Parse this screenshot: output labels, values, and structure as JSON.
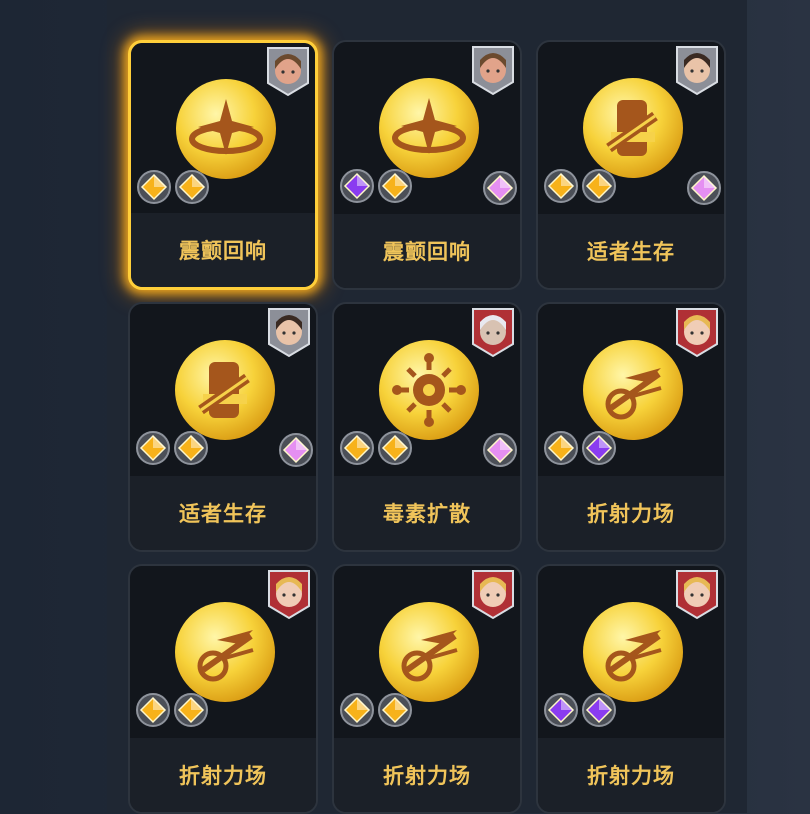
{
  "cards": [
    {
      "name": "震颤回响",
      "icon": "swirl-icon",
      "portrait": "dwarf-portrait",
      "selected": true,
      "gems": [
        "gold",
        "gold"
      ],
      "extra_gem": null
    },
    {
      "name": "震颤回响",
      "icon": "swirl-icon",
      "portrait": "dwarf-portrait",
      "selected": false,
      "gems": [
        "purple",
        "gold"
      ],
      "extra_gem": "pink"
    },
    {
      "name": "适者生存",
      "icon": "sword-fist-icon",
      "portrait": "dark-hair-hero-portrait",
      "selected": false,
      "gems": [
        "gold",
        "gold"
      ],
      "extra_gem": "pink"
    },
    {
      "name": "适者生存",
      "icon": "sword-fist-icon",
      "portrait": "dark-hair-hero-portrait",
      "selected": false,
      "gems": [
        "gold",
        "gold"
      ],
      "extra_gem": "pink"
    },
    {
      "name": "毒素扩散",
      "icon": "virus-icon",
      "portrait": "old-mage-portrait",
      "selected": false,
      "gems": [
        "gold",
        "gold"
      ],
      "extra_gem": "pink"
    },
    {
      "name": "折射力场",
      "icon": "refract-field-icon",
      "portrait": "blonde-heroine-portrait",
      "selected": false,
      "gems": [
        "gold",
        "purple"
      ],
      "extra_gem": null
    },
    {
      "name": "折射力场",
      "icon": "refract-field-icon",
      "portrait": "blonde-heroine-portrait",
      "selected": false,
      "gems": [
        "gold",
        "gold"
      ],
      "extra_gem": null
    },
    {
      "name": "折射力场",
      "icon": "refract-field-icon",
      "portrait": "blonde-heroine-portrait",
      "selected": false,
      "gems": [
        "gold",
        "gold"
      ],
      "extra_gem": null
    },
    {
      "name": "折射力场",
      "icon": "refract-field-icon",
      "portrait": "blonde-heroine-portrait",
      "selected": false,
      "gems": [
        "purple",
        "purple"
      ],
      "extra_gem": null
    }
  ],
  "colors": {
    "accent": "#ffcf3a",
    "name_text": "#f0c45a",
    "gold_gem": "#f7b21a",
    "purple_gem": "#8a3cf0",
    "pink_gem": "#e58ff2"
  }
}
